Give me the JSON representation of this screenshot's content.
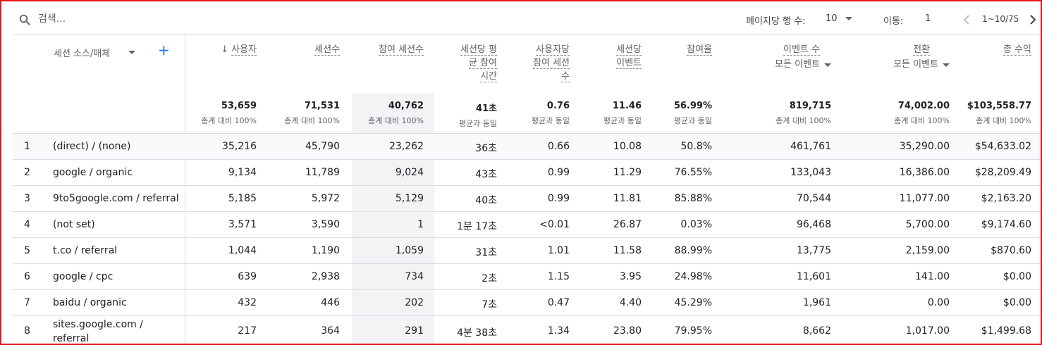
{
  "toolbar": {
    "search_placeholder": "검색...",
    "rows_per_page_label": "페이지당 행 수:",
    "rows_per_page_value": "10",
    "goto_label": "이동:",
    "goto_value": "1",
    "range_text": "1~10/75"
  },
  "table": {
    "dimension_header": "세션 소스/매체",
    "add_dimension": "+",
    "columns": [
      {
        "label": "사용자",
        "sorted": "desc"
      },
      {
        "label": "세션수"
      },
      {
        "label": "참여 세션수"
      },
      {
        "label": "세션당 평균 참여 시간"
      },
      {
        "label": "사용자당 참여 세션수"
      },
      {
        "label": "세션당 이벤트"
      },
      {
        "label": "참여율"
      },
      {
        "label": "이벤트 수",
        "filter": "모든 이벤트"
      },
      {
        "label": "전환",
        "filter": "모든 이벤트"
      },
      {
        "label": "총 수익"
      }
    ],
    "totals": [
      {
        "value": "53,659",
        "note": "총계 대비 100%"
      },
      {
        "value": "71,531",
        "note": "총계 대비 100%"
      },
      {
        "value": "40,762",
        "note": "총계 대비 100%"
      },
      {
        "value": "41초",
        "note": "평균과 동일"
      },
      {
        "value": "0.76",
        "note": "평균과 동일"
      },
      {
        "value": "11.46",
        "note": "평균과 동일"
      },
      {
        "value": "56.99%",
        "note": "평균과 동일"
      },
      {
        "value": "819,715",
        "note": "총계 대비 100%"
      },
      {
        "value": "74,002.00",
        "note": "총계 대비 100%"
      },
      {
        "value": "$103,558.77",
        "note": "총계 대비 100%"
      }
    ],
    "rows": [
      {
        "idx": "1",
        "dim": "(direct) / (none)",
        "v": [
          "35,216",
          "45,790",
          "23,262",
          "36초",
          "0.66",
          "10.08",
          "50.8%",
          "461,761",
          "35,290.00",
          "$54,633.02"
        ]
      },
      {
        "idx": "2",
        "dim": "google / organic",
        "v": [
          "9,134",
          "11,789",
          "9,024",
          "43초",
          "0.99",
          "11.29",
          "76.55%",
          "133,043",
          "16,386.00",
          "$28,209.49"
        ]
      },
      {
        "idx": "3",
        "dim": "9to5google.com / referral",
        "v": [
          "5,185",
          "5,972",
          "5,129",
          "40초",
          "0.99",
          "11.81",
          "85.88%",
          "70,544",
          "11,077.00",
          "$2,163.20"
        ]
      },
      {
        "idx": "4",
        "dim": "(not set)",
        "v": [
          "3,571",
          "3,590",
          "1",
          "1분 17초",
          "<0.01",
          "26.87",
          "0.03%",
          "96,468",
          "5,700.00",
          "$9,174.60"
        ]
      },
      {
        "idx": "5",
        "dim": "t.co / referral",
        "v": [
          "1,044",
          "1,190",
          "1,059",
          "31초",
          "1.01",
          "11.58",
          "88.99%",
          "13,775",
          "2,159.00",
          "$870.60"
        ]
      },
      {
        "idx": "6",
        "dim": "google / cpc",
        "v": [
          "639",
          "2,938",
          "734",
          "2초",
          "1.15",
          "3.95",
          "24.98%",
          "11,601",
          "141.00",
          "$0.00"
        ]
      },
      {
        "idx": "7",
        "dim": "baidu / organic",
        "v": [
          "432",
          "446",
          "202",
          "7초",
          "0.47",
          "4.40",
          "45.29%",
          "1,961",
          "0.00",
          "$0.00"
        ]
      },
      {
        "idx": "8",
        "dim": "sites.google.com / referral",
        "v": [
          "217",
          "364",
          "291",
          "4분 38초",
          "1.34",
          "23.80",
          "79.95%",
          "8,662",
          "1,017.00",
          "$1,499.68"
        ]
      }
    ]
  }
}
